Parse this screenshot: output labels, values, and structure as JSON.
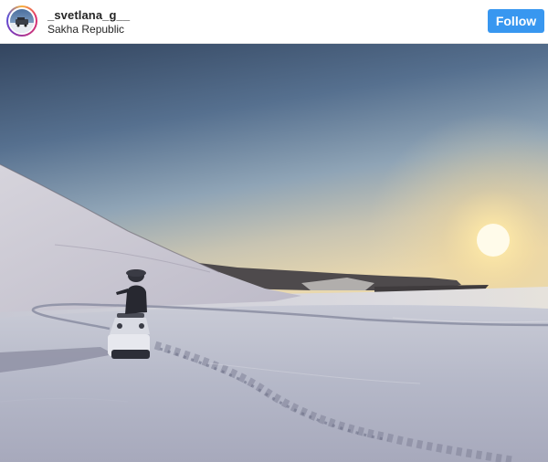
{
  "header": {
    "username": "_svetlana_g__",
    "location": "Sakha Republic",
    "follow_label": "Follow"
  },
  "avatar": {
    "icon": "profile-avatar"
  },
  "photo": {
    "description_icon": "snowmobile-landscape-photo"
  },
  "colors": {
    "follow_button": "#3897f0",
    "username_text": "#262626"
  }
}
